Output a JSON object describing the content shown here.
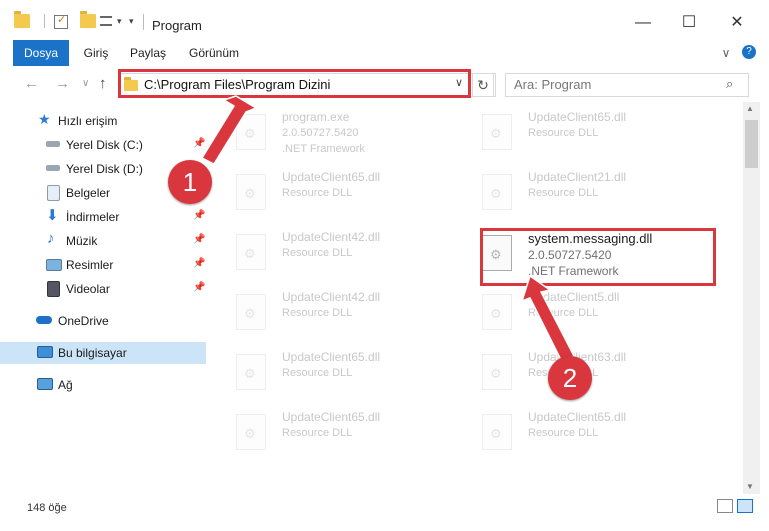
{
  "window": {
    "title": "Program",
    "minimize_glyph": "—",
    "maximize_glyph": "☐",
    "close_glyph": "✕"
  },
  "ribbon": {
    "tabs": [
      "Dosya",
      "Giriş",
      "Paylaş",
      "Görünüm"
    ],
    "collapse_glyph": "∨",
    "help_glyph": "?"
  },
  "nav": {
    "back_glyph": "←",
    "forward_glyph": "→",
    "recent_glyph": "∨",
    "up_glyph": "↑"
  },
  "address": {
    "path": "C:\\Program Files\\Program Dizini",
    "dropdown_glyph": "∨",
    "refresh_glyph": "↻"
  },
  "search": {
    "placeholder": "Ara: Program",
    "icon_glyph": "⌕"
  },
  "sidebar": {
    "items": [
      {
        "label": "Hızlı erişim",
        "icon": "star-icon"
      },
      {
        "label": "Yerel Disk (C:)",
        "icon": "drive-icon"
      },
      {
        "label": "Yerel Disk (D:)",
        "icon": "drive-icon"
      },
      {
        "label": "Belgeler",
        "icon": "documents-icon"
      },
      {
        "label": "İndirmeler",
        "icon": "download-icon"
      },
      {
        "label": "Müzik",
        "icon": "music-icon"
      },
      {
        "label": "Resimler",
        "icon": "pictures-icon"
      },
      {
        "label": "Videolar",
        "icon": "video-icon"
      },
      {
        "label": "OneDrive",
        "icon": "cloud-icon"
      },
      {
        "label": "Bu bilgisayar",
        "icon": "computer-icon"
      },
      {
        "label": "Ağ",
        "icon": "network-icon"
      }
    ],
    "pin_glyph": "📌"
  },
  "files": [
    {
      "name": "program.exe",
      "line1": "2.0.50727.5420",
      "line2": ".NET Framework"
    },
    {
      "name": "UpdateClient65.dll",
      "line1": "Resource DLL",
      "line2": ""
    },
    {
      "name": "UpdateClient65.dll",
      "line1": "Resource DLL",
      "line2": ""
    },
    {
      "name": "UpdateClient21.dll",
      "line1": "Resource DLL",
      "line2": ""
    },
    {
      "name": "UpdateClient42.dll",
      "line1": "Resource DLL",
      "line2": ""
    },
    {
      "name": "system.messaging.dll",
      "line1": "2.0.50727.5420",
      "line2": ".NET Framework"
    },
    {
      "name": "UpdateClient42.dll",
      "line1": "Resource DLL",
      "line2": ""
    },
    {
      "name": "UpdateClient5.dll",
      "line1": "Resource DLL",
      "line2": ""
    },
    {
      "name": "UpdateClient65.dll",
      "line1": "Resource DLL",
      "line2": ""
    },
    {
      "name": "UpdateClient63.dll",
      "line1": "Resource DLL",
      "line2": ""
    },
    {
      "name": "UpdateClient65.dll",
      "line1": "Resource DLL",
      "line2": ""
    },
    {
      "name": "UpdateClient65.dll",
      "line1": "Resource DLL",
      "line2": ""
    }
  ],
  "annotations": {
    "step1": "1",
    "step2": "2",
    "color": "#d9363e"
  },
  "status": {
    "item_count": "148 öğe"
  },
  "colors": {
    "accent": "#1a73c9",
    "selected_nav": "#cce4f7",
    "highlight": "#d9363e"
  }
}
